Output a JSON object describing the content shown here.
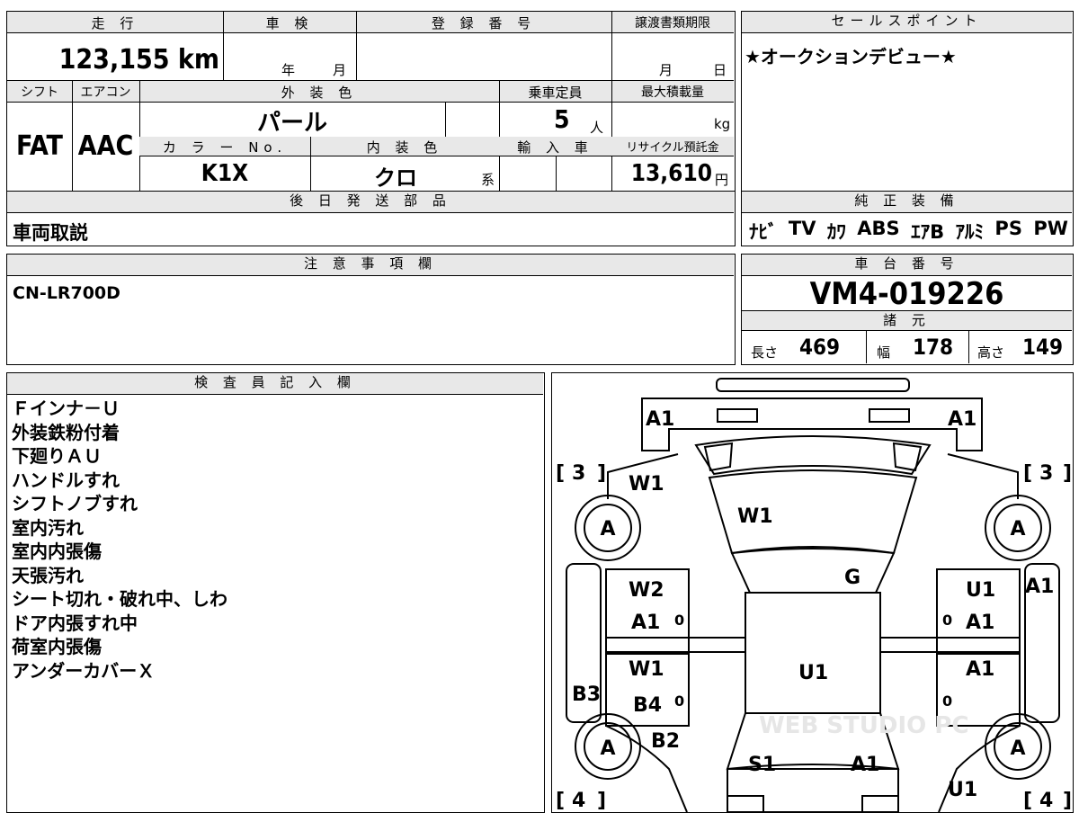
{
  "top_table": {
    "mileage_label": "走 行",
    "mileage_value": "123,155 km",
    "shaken_label": "車 検",
    "shaken_year_unit": "年",
    "shaken_month_unit": "月",
    "reg_label": "登 録 番 号",
    "deadline_label": "譲渡書類期限",
    "deadline_month_unit": "月",
    "deadline_day_unit": "日",
    "shift_label": "シフト",
    "shift_value": "FAT",
    "ac_label": "エアコン",
    "ac_value": "AAC",
    "exterior_label": "外 装 色",
    "exterior_value": "パール",
    "capacity_label": "乗車定員",
    "capacity_value": "5",
    "capacity_unit": "人",
    "maxload_label": "最大積載量",
    "maxload_unit": "kg",
    "color_no_label": "カ ラ ー No.",
    "color_no_value": "K1X",
    "interior_label": "内 装 色",
    "interior_value": "クロ",
    "interior_suffix": "系",
    "import_label": "輸 入 車",
    "recycle_label": "リサイクル預託金",
    "recycle_value": "13,610",
    "recycle_unit": "円",
    "later_parts_label": "後 日 発 送 部 品",
    "later_parts_value": "車両取説"
  },
  "sales_point": {
    "label": "セールスポイント",
    "text": "★オークションデビュー★"
  },
  "equipment": {
    "label": "純 正 装 備",
    "items": [
      "ﾅﾋﾞ",
      "TV",
      "ｶﾜ",
      "ABS",
      "ｴｱB",
      "ｱﾙﾐ",
      "PS",
      "PW"
    ]
  },
  "notes": {
    "label": "注 意 事 項 欄",
    "text": "CN-LR700D"
  },
  "chassis": {
    "label": "車 台 番 号",
    "value": "VM4-019226",
    "specs_label": "諸 元",
    "length_label": "長さ",
    "length_value": "469",
    "width_label": "幅",
    "width_value": "178",
    "height_label": "高さ",
    "height_value": "149"
  },
  "inspector": {
    "label": "検 査 員 記 入 欄",
    "lines": [
      "Ｆインナ－Ｕ",
      "外装鉄粉付着",
      "下廻りＡＵ",
      "ハンドルすれ",
      "シフトノブすれ",
      "室内汚れ",
      "室内内張傷",
      "天張汚れ",
      "シート切れ・破れ中、しわ",
      "ドア内張すれ中",
      "荷室内張傷",
      "アンダーカバーＸ"
    ]
  },
  "diagram": {
    "marks": [
      "A1",
      "A1",
      "W1",
      "W1",
      "G",
      "W2",
      "A1",
      "U1",
      "A1",
      "A1",
      "W1",
      "U1",
      "A1",
      "B3",
      "B4",
      "B2",
      "S1",
      "A1",
      "U1"
    ],
    "wheel_marks": [
      "A",
      "A",
      "A",
      "A"
    ],
    "tire_front_left": "3",
    "tire_front_right": "3",
    "tire_rear_left": "4",
    "tire_rear_right": "4",
    "small_zero": "0",
    "watermark": "WEB STUDIO PC"
  }
}
